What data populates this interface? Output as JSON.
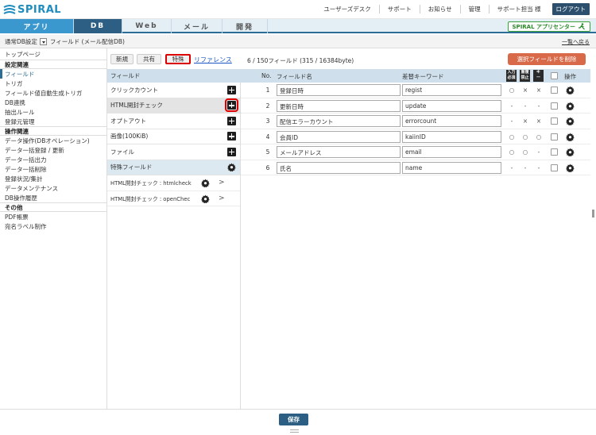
{
  "header": {
    "logo": "SPIRAL",
    "links": [
      "ユーザーズデスク",
      "サポート",
      "お知らせ",
      "管理",
      "サポート担当 様"
    ],
    "logout": "ログアウト"
  },
  "nav": {
    "tabs": [
      "アプリ",
      "DB",
      "Web",
      "メール",
      "開発"
    ],
    "active": "DB",
    "app_center": "SPIRAL アプリセンター"
  },
  "breadcrumb": {
    "db_setting": "通常DB設定",
    "current": "フィールド (メール配信DB)",
    "back": "一覧へ戻る"
  },
  "sidebar": {
    "items": [
      {
        "label": "トップページ",
        "type": "item"
      },
      {
        "label": "設定関連",
        "type": "head"
      },
      {
        "label": "フィールド",
        "type": "active"
      },
      {
        "label": "トリガ",
        "type": "item"
      },
      {
        "label": "フィールド値自動生成トリガ",
        "type": "item"
      },
      {
        "label": "DB連携",
        "type": "item"
      },
      {
        "label": "抽出ルール",
        "type": "item"
      },
      {
        "label": "登録元管理",
        "type": "item"
      },
      {
        "label": "操作関連",
        "type": "head"
      },
      {
        "label": "データ操作(DBオペレーション)",
        "type": "item"
      },
      {
        "label": "データ一括登録 / 更新",
        "type": "item"
      },
      {
        "label": "データ一括出力",
        "type": "item"
      },
      {
        "label": "データ一括削除",
        "type": "item"
      },
      {
        "label": "登録状況/集計",
        "type": "item"
      },
      {
        "label": "データメンテナンス",
        "type": "item"
      },
      {
        "label": "DB操作履歴",
        "type": "item"
      },
      {
        "label": "その他",
        "type": "head"
      },
      {
        "label": "PDF帳票",
        "type": "item"
      },
      {
        "label": "宛名ラベル制作",
        "type": "item"
      }
    ]
  },
  "toolbar": {
    "new": "新規",
    "share": "共有",
    "special": "特殊",
    "reference": "リファレンス",
    "count": "6 / 150フィールド (315 / 16384byte)",
    "delete": "選択フィールドを削除"
  },
  "field_panel": {
    "header": "フィールド",
    "types": [
      "クリックカウント",
      "HTML開封チェック",
      "オプトアウト",
      "画像(100KiB)",
      "ファイル"
    ],
    "special_header": "特殊フィールド",
    "special_items": [
      "HTML開封チェック : htmlcheck",
      "HTML開封チェック : openChec"
    ]
  },
  "table": {
    "headers": {
      "no": "No.",
      "name": "フィールド名",
      "keyword": "差替キーワード",
      "op": "操作"
    },
    "badges": [
      {
        "icon": "input-required-badge",
        "text": "入力\n必須"
      },
      {
        "icon": "duplicate-prohibit-badge",
        "text": "重複\n禁止"
      },
      {
        "icon": "key-badge",
        "text": "キー"
      }
    ],
    "rows": [
      {
        "no": "1",
        "name": "登録日時",
        "key": "regist",
        "req": "○",
        "dup": "×",
        "key_mark": "×"
      },
      {
        "no": "2",
        "name": "更新日時",
        "key": "update",
        "req": "-",
        "dup": "-",
        "key_mark": "-"
      },
      {
        "no": "3",
        "name": "配信エラーカウント",
        "key": "errorcount",
        "req": "-",
        "dup": "×",
        "key_mark": "×"
      },
      {
        "no": "4",
        "name": "会員ID",
        "key": "kaiinID",
        "req": "○",
        "dup": "○",
        "key_mark": "○"
      },
      {
        "no": "5",
        "name": "メールアドレス",
        "key": "email",
        "req": "○",
        "dup": "○",
        "key_mark": "-"
      },
      {
        "no": "6",
        "name": "氏名",
        "key": "name",
        "req": "-",
        "dup": "-",
        "key_mark": "-"
      }
    ]
  },
  "footer": {
    "save": "保存"
  }
}
